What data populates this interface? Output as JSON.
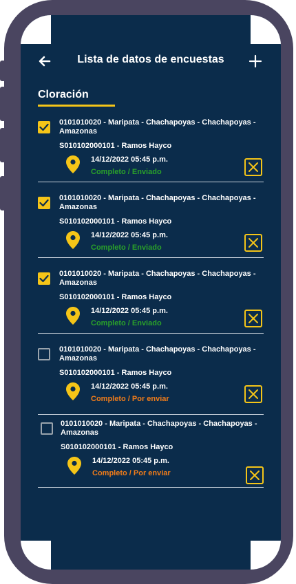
{
  "header": {
    "title": "Lista de datos de encuestas",
    "back_icon": "arrow-left-icon",
    "add_icon": "plus-icon"
  },
  "tab": {
    "label": "Cloración"
  },
  "colors": {
    "background": "#0b2c4b",
    "accent": "#f5c518",
    "status_sent": "#2aa12a",
    "status_pending": "#f07c1a"
  },
  "items": [
    {
      "checked": true,
      "location": "0101010020 - Maripata - Chachapoyas - Chachapoyas - Amazonas",
      "code": "S010102000101 - Ramos Hayco",
      "datetime": "14/12/2022 05:45 p.m.",
      "status": "Completo / Enviado",
      "status_kind": "sent"
    },
    {
      "checked": true,
      "location": "0101010020 - Maripata - Chachapoyas - Chachapoyas - Amazonas",
      "code": "S010102000101 - Ramos Hayco",
      "datetime": "14/12/2022 05:45 p.m.",
      "status": "Completo / Enviado",
      "status_kind": "sent"
    },
    {
      "checked": true,
      "location": "0101010020 - Maripata - Chachapoyas - Chachapoyas - Amazonas",
      "code": "S010102000101 - Ramos Hayco",
      "datetime": "14/12/2022 05:45 p.m.",
      "status": "Completo / Enviado",
      "status_kind": "sent"
    },
    {
      "checked": false,
      "location": "0101010020 - Maripata - Chachapoyas - Chachapoyas - Amazonas",
      "code": "S010102000101 - Ramos Hayco",
      "datetime": "14/12/2022 05:45 p.m.",
      "status": "Completo / Por enviar",
      "status_kind": "pending"
    },
    {
      "checked": false,
      "location": "0101010020 - Maripata - Chachapoyas - Chachapoyas - Amazonas",
      "code": "S010102000101 - Ramos Hayco",
      "datetime": "14/12/2022 05:45 p.m.",
      "status": "Completo / Por enviar",
      "status_kind": "pending"
    }
  ]
}
